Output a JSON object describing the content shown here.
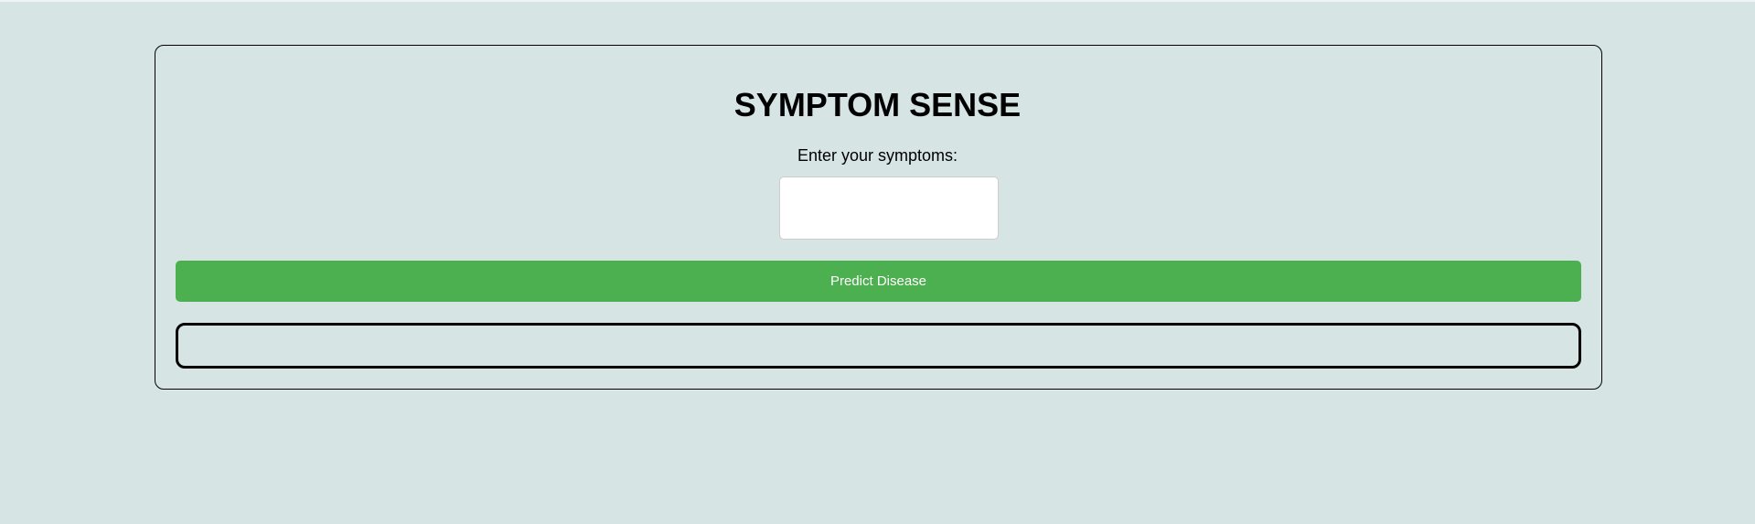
{
  "app": {
    "title": "SYMPTOM SENSE"
  },
  "form": {
    "symptoms_label": "Enter your symptoms:",
    "symptoms_value": "",
    "predict_button": "Predict Disease"
  },
  "result": {
    "text": ""
  },
  "colors": {
    "accent": "#4caf50",
    "background": "#d6e4e4"
  }
}
